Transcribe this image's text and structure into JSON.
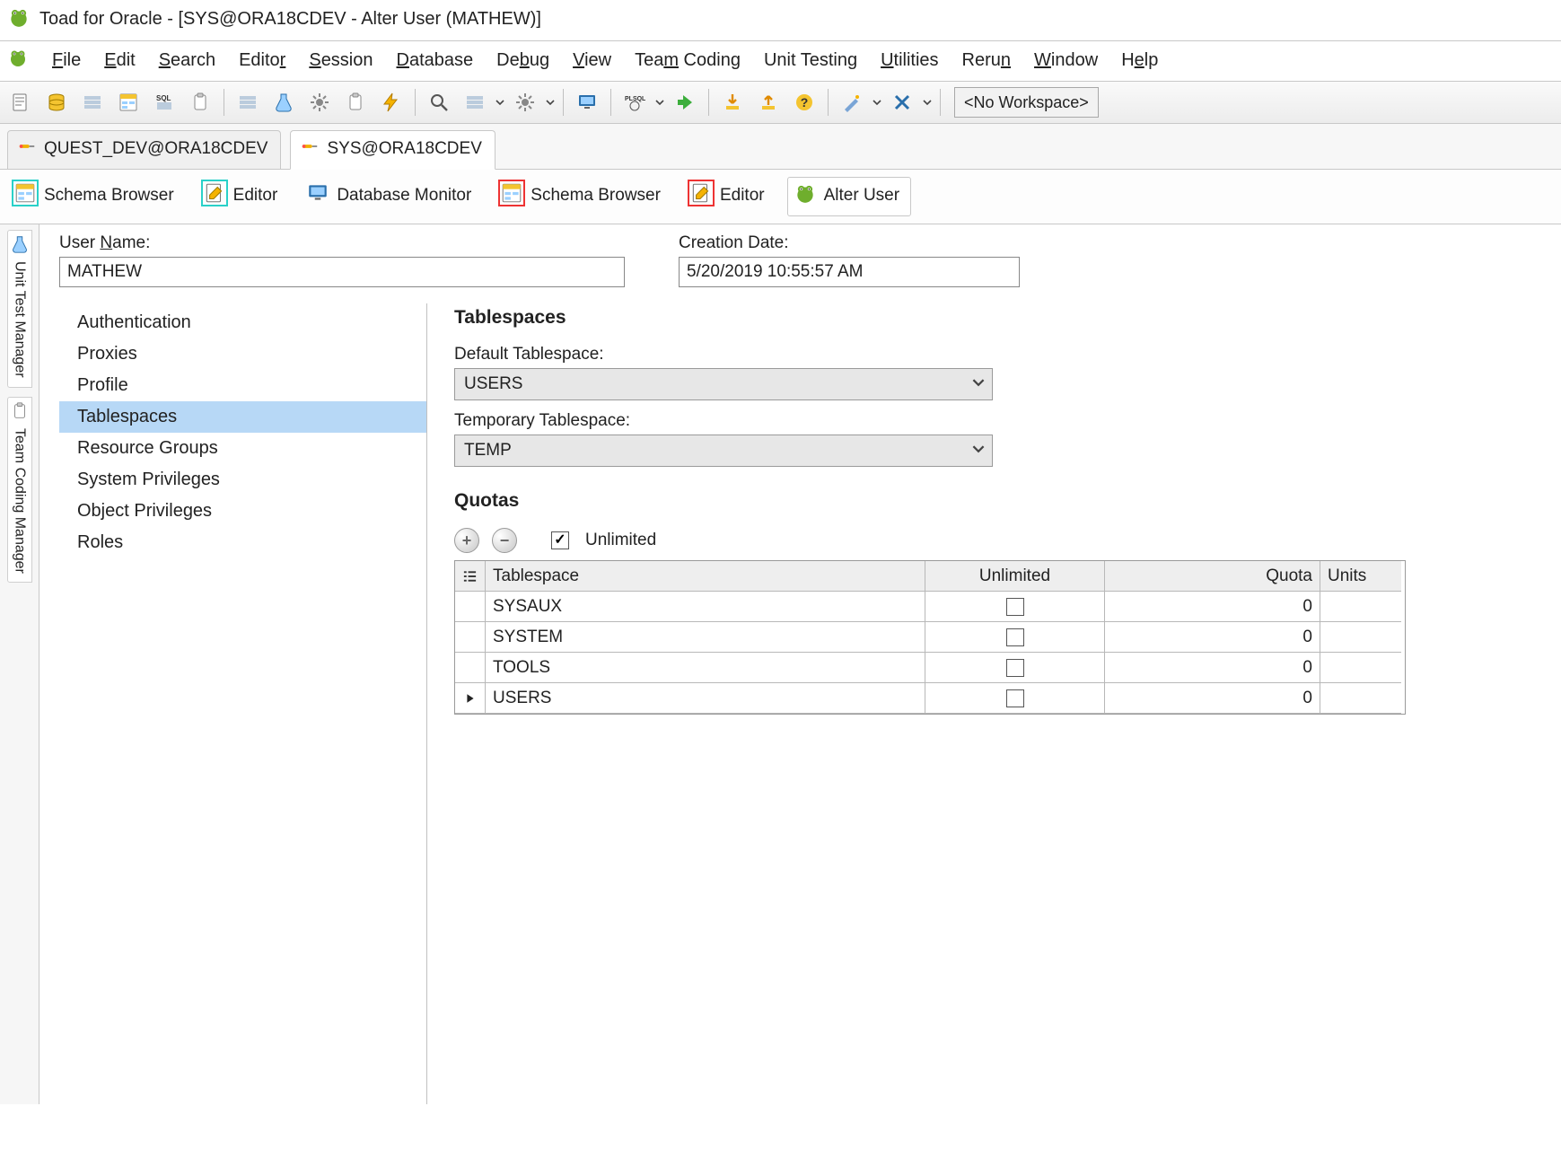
{
  "title": "Toad for Oracle - [SYS@ORA18CDEV - Alter User (MATHEW)]",
  "menu": {
    "file": "File",
    "edit": "Edit",
    "search": "Search",
    "editor": "Editor",
    "session": "Session",
    "database": "Database",
    "debug": "Debug",
    "view": "View",
    "team": "Team Coding",
    "unit": "Unit Testing",
    "utilities": "Utilities",
    "rerun": "Rerun",
    "window": "Window",
    "help": "Help"
  },
  "toolbar": {
    "workspace": "<No Workspace>"
  },
  "conn_tabs": {
    "a": "QUEST_DEV@ORA18CDEV",
    "b": "SYS@ORA18CDEV"
  },
  "doc_tabs": {
    "schema1": "Schema Browser",
    "editor1": "Editor",
    "dbmon": "Database Monitor",
    "schema2": "Schema Browser",
    "editor2": "Editor",
    "alter": "Alter User"
  },
  "side_strip": {
    "unit": "Unit Test Manager",
    "team": "Team Coding Manager"
  },
  "header": {
    "user_label": "User Name:",
    "user_value": "MATHEW",
    "date_label": "Creation Date:",
    "date_value": "5/20/2019 10:55:57 AM"
  },
  "nav": [
    "Authentication",
    "Proxies",
    "Profile",
    "Tablespaces",
    "Resource Groups",
    "System Privileges",
    "Object Privileges",
    "Roles"
  ],
  "nav_selected_index": 3,
  "tablespaces": {
    "title": "Tablespaces",
    "default_label": "Default Tablespace:",
    "default_value": "USERS",
    "temp_label": "Temporary Tablespace:",
    "temp_value": "TEMP",
    "quotas_title": "Quotas",
    "unlimited_label": "Unlimited",
    "unlimited_checked": true,
    "grid": {
      "h_tablespace": "Tablespace",
      "h_unlimited": "Unlimited",
      "h_quota": "Quota",
      "h_units": "Units",
      "rows": [
        {
          "name": "SYSAUX",
          "unlimited": false,
          "quota": "0",
          "units": ""
        },
        {
          "name": "SYSTEM",
          "unlimited": false,
          "quota": "0",
          "units": ""
        },
        {
          "name": "TOOLS",
          "unlimited": false,
          "quota": "0",
          "units": ""
        },
        {
          "name": "USERS",
          "unlimited": false,
          "quota": "0",
          "units": ""
        }
      ],
      "current_row_index": 3
    }
  }
}
